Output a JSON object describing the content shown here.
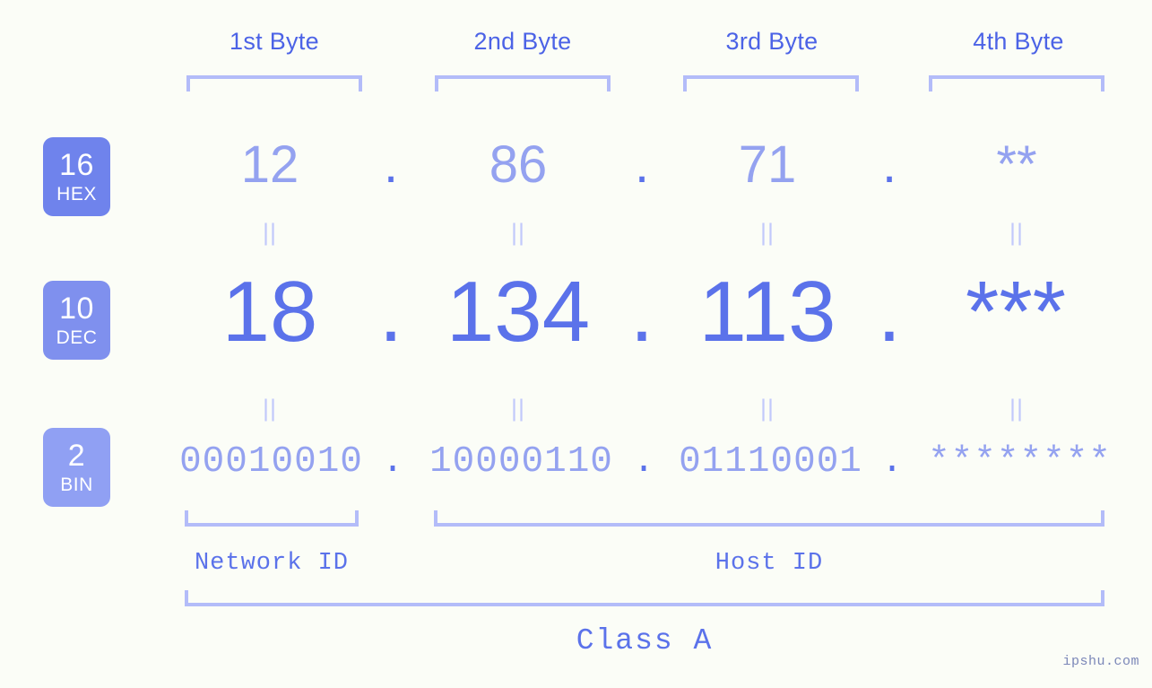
{
  "meta": {
    "background_color": "#fbfdf7",
    "accent_color": "#5b72ea",
    "accent_light_color": "#94a2f0",
    "bracket_color": "#b3bcf9",
    "badge_hex_color": "#6f83ec",
    "badge_dec_color": "#7f90ee",
    "badge_bin_color": "#90a0f3"
  },
  "headers": {
    "bytes": [
      {
        "label": "1st Byte"
      },
      {
        "label": "2nd Byte"
      },
      {
        "label": "3rd Byte"
      },
      {
        "label": "4th Byte"
      }
    ]
  },
  "bases": [
    {
      "number": "16",
      "name": "HEX"
    },
    {
      "number": "10",
      "name": "DEC"
    },
    {
      "number": "2",
      "name": "BIN"
    }
  ],
  "rows": {
    "hex": {
      "base_number": "16",
      "base_name": "HEX",
      "octets": [
        "12",
        "86",
        "71",
        "**"
      ],
      "separator": "."
    },
    "dec": {
      "base_number": "10",
      "base_name": "DEC",
      "octets": [
        "18",
        "134",
        "113",
        "***"
      ],
      "separator": "."
    },
    "bin": {
      "base_number": "2",
      "base_name": "BIN",
      "octets": [
        "00010010",
        "10000110",
        "01110001",
        "********"
      ],
      "separator": "."
    }
  },
  "equals": {
    "symbol": "||",
    "rows": [
      {
        "marks": [
          "||",
          "||",
          "||",
          "||"
        ]
      },
      {
        "marks": [
          "||",
          "||",
          "||",
          "||"
        ]
      }
    ]
  },
  "footer": {
    "network_id_label": "Network ID",
    "host_id_label": "Host ID",
    "class_label": "Class A",
    "watermark": "ipshu.com"
  }
}
